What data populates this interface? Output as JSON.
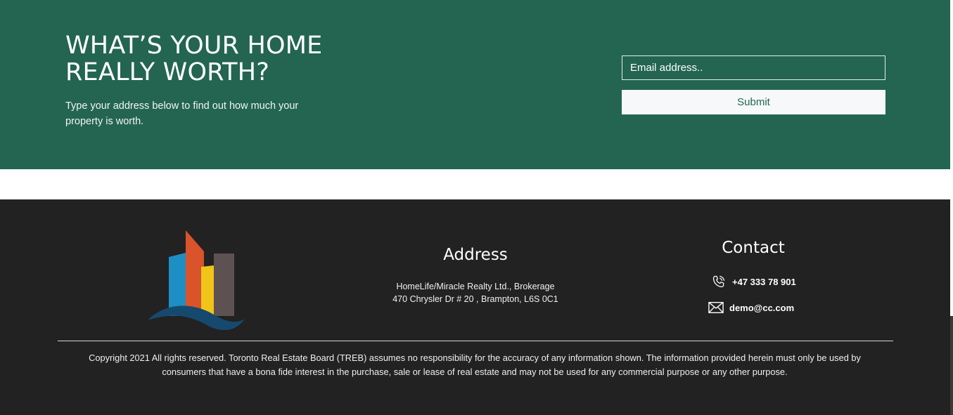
{
  "cta": {
    "title": "WHAT’S YOUR HOME REALLY WORTH?",
    "subtitle": "Type your address below to find out how much your property is worth.",
    "email_placeholder": "Email address..",
    "submit_label": "Submit"
  },
  "footer": {
    "logo_icon": "city-buildings-logo-icon",
    "address": {
      "heading": "Address",
      "line1": "HomeLife/Miracle Realty Ltd., Brokerage",
      "line2": "470 Chrysler Dr # 20 , Brampton, L6S 0C1"
    },
    "contact": {
      "heading": "Contact",
      "phone_icon": "phone-icon",
      "phone": "+47 333 78 901",
      "email_icon": "envelope-icon",
      "email": "demo@cc.com"
    },
    "copyright": "Copyright 2021 All rights reserved. Toronto Real Estate Board (TREB) assumes no responsibility for the accuracy of any information shown. The information provided herein must only be used by consumers that have a bona fide interest in the purchase, sale or lease of real estate and may not be used for any commercial purpose or any other purpose."
  },
  "colors": {
    "hero_bg": "#236550",
    "footer_bg": "#222222",
    "button_bg": "#f7f8fa",
    "logo_blue": "#1e8fc4",
    "logo_red": "#d9532b",
    "logo_yellow": "#f0c419",
    "logo_gray": "#5e5152",
    "logo_wave": "#154a6e"
  }
}
